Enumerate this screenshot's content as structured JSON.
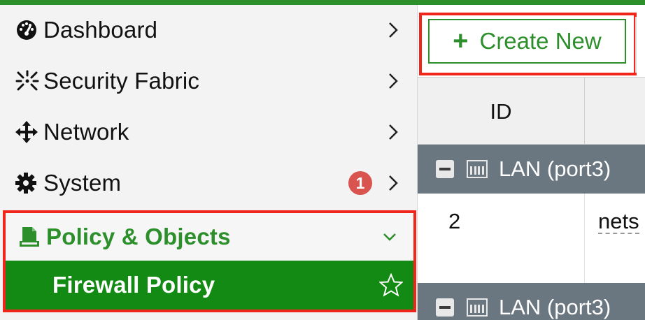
{
  "sidebar": {
    "items": [
      {
        "label": "Dashboard",
        "icon": "dashboard-gauge-icon"
      },
      {
        "label": "Security Fabric",
        "icon": "security-fabric-icon"
      },
      {
        "label": "Network",
        "icon": "network-arrows-icon"
      },
      {
        "label": "System",
        "icon": "gear-icon",
        "badge": "1"
      }
    ],
    "policy": {
      "label": "Policy & Objects",
      "icon": "policy-objects-icon",
      "subitem": "Firewall Policy"
    }
  },
  "toolbar": {
    "create_label": "Create New",
    "create_icon": "plus-icon"
  },
  "table": {
    "columns": [
      "ID"
    ],
    "groups": [
      {
        "label": "LAN (port3)"
      },
      {
        "label": "LAN (port3)"
      }
    ],
    "rows": [
      {
        "id": "2",
        "name": "nets"
      }
    ]
  },
  "colors": {
    "accent": "#2c8f2b",
    "active_bg": "#138a13",
    "highlight": "#f0261b",
    "group_bg": "#6b7780",
    "badge": "#d9534f"
  }
}
